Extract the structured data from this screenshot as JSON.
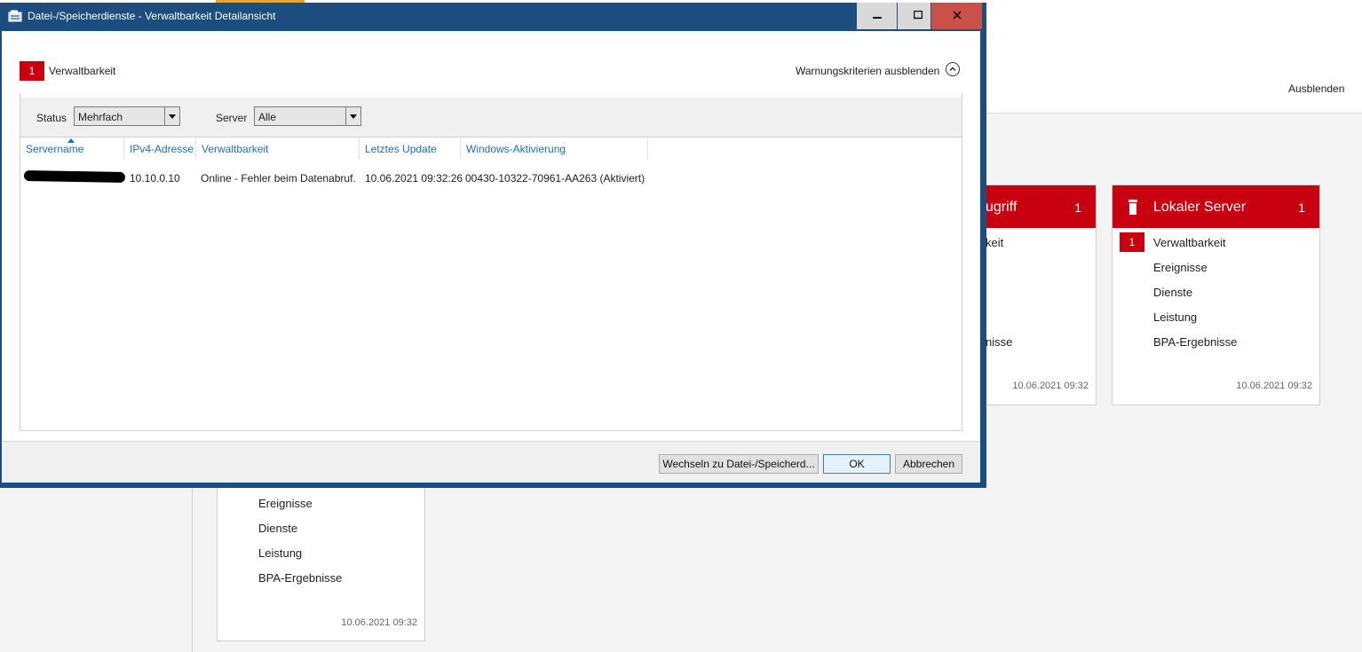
{
  "background": {
    "hide_label": "Ausblenden",
    "tile_partial": {
      "title": "ugriff",
      "count": "1",
      "items": [
        "keit",
        "nisse"
      ],
      "timestamp": "10.06.2021 09:32"
    },
    "tile_local": {
      "title": "Lokaler Server",
      "count": "1",
      "badge": "1",
      "items": [
        "Verwaltbarkeit",
        "Ereignisse",
        "Dienste",
        "Leistung",
        "BPA-Ergebnisse"
      ],
      "timestamp": "10.06.2021 09:32"
    },
    "tile_bottom": {
      "items": [
        "Ereignisse",
        "Dienste",
        "Leistung",
        "BPA-Ergebnisse"
      ],
      "timestamp": "10.06.2021 09:32"
    }
  },
  "dialog": {
    "title": "Datei-/Speicherdienste - Verwaltbarkeit Detailansicht",
    "window_buttons": {
      "minimize": "🗕",
      "maximize": "🗖",
      "close": "✕"
    },
    "criteria": {
      "badge": "1",
      "label": "Verwaltbarkeit"
    },
    "warning_toggle": "Warnungskriterien ausblenden",
    "filters": {
      "status_label": "Status",
      "status_value": "Mehrfach",
      "server_label": "Server",
      "server_value": "Alle"
    },
    "columns": [
      "Servername",
      "IPv4-Adresse",
      "Verwaltbarkeit",
      "Letztes Update",
      "Windows-Aktivierung"
    ],
    "rows": [
      {
        "servername": "",
        "ipv4": "10.10.0.10",
        "verwaltbarkeit": "Online - Fehler beim Datenabruf.",
        "letztes_update": "10.06.2021 09:32:26",
        "aktivierung": "00430-10322-70961-AA263 (Aktiviert)"
      }
    ],
    "buttons": {
      "switch": "Wechseln zu Datei-/Speicherd...",
      "ok": "OK",
      "cancel": "Abbrechen"
    }
  }
}
